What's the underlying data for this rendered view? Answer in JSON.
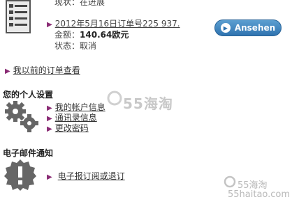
{
  "order": {
    "status_top": "现状：在进展",
    "link": "2012年5月16日订单号225 937.",
    "amount_label": "金额：",
    "amount_value": "140.64欧元",
    "status": "状态：取消",
    "button_label": "Ansehen"
  },
  "previous_orders": "我以前的订单查看",
  "personal_settings": {
    "title": "您的个人设置",
    "items": [
      "我的帐户信息",
      "通讯录信息",
      "更改密码"
    ]
  },
  "email": {
    "title": "电子邮件通知",
    "link": "电子报订阅或退订"
  },
  "watermark": {
    "center": "55海淘",
    "right_top": "55海淘",
    "right_bottom": "55haitao.com"
  },
  "colors": {
    "bullet": "#8a2b74",
    "button": "#2f73b0"
  }
}
